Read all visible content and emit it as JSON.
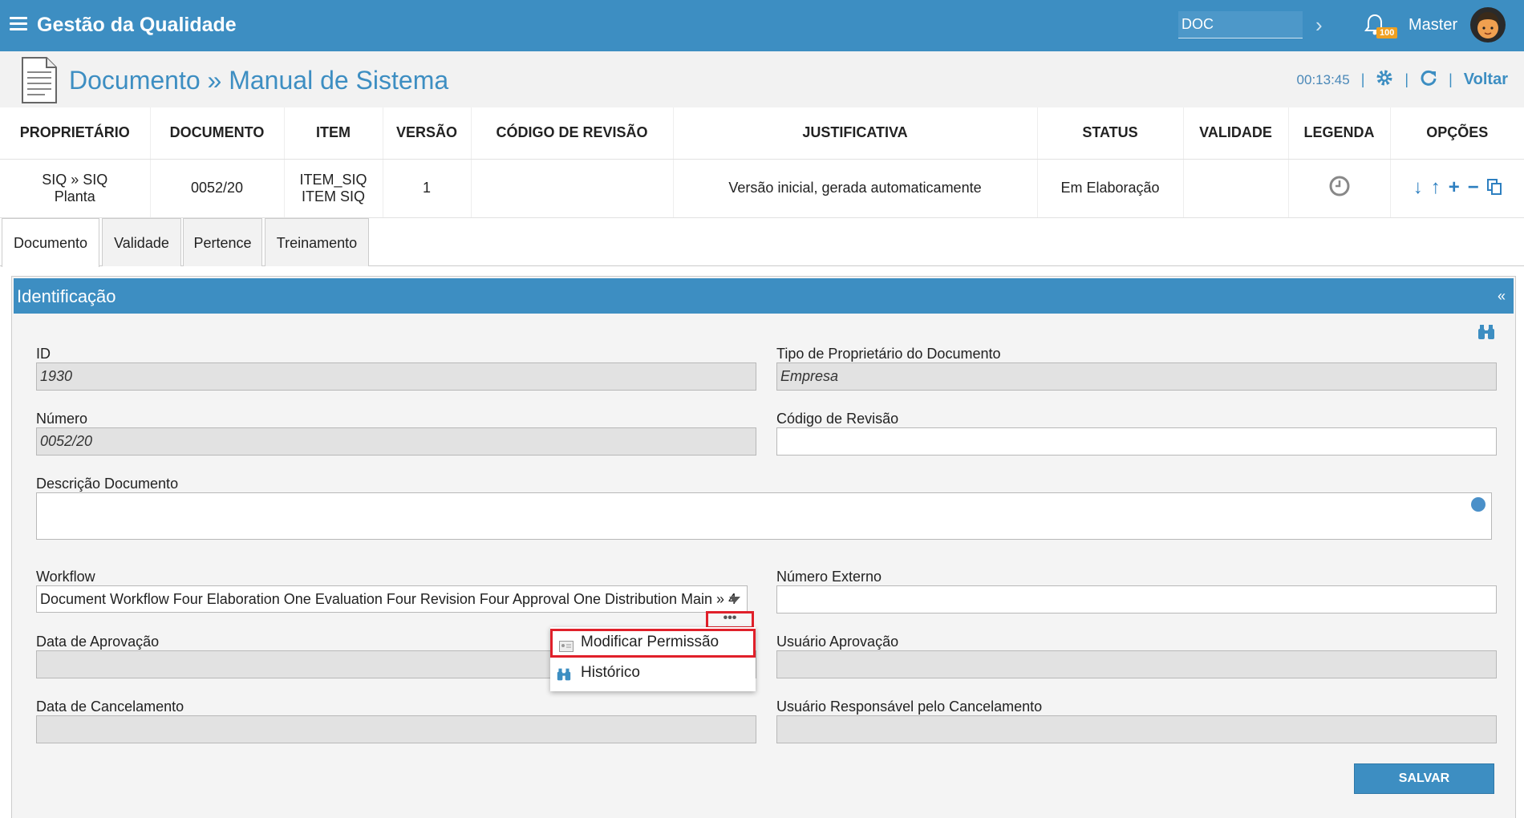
{
  "app": {
    "title": "Gestão da Qualidade"
  },
  "topbar": {
    "search_value": "DOC",
    "notification_count": "100",
    "user_name": "Master"
  },
  "header": {
    "title": "Documento » Manual de Sistema",
    "timer": "00:13:45",
    "back_label": "Voltar",
    "sep": "|"
  },
  "table": {
    "headers": [
      "PROPRIETÁRIO",
      "DOCUMENTO",
      "ITEM",
      "VERSÃO",
      "CÓDIGO DE REVISÃO",
      "JUSTIFICATIVA",
      "STATUS",
      "VALIDADE",
      "LEGENDA",
      "OPÇÕES"
    ],
    "row": {
      "proprietario_1": "SIQ » SIQ",
      "proprietario_2": "Planta",
      "documento": "0052/20",
      "item_1": "ITEM_SIQ",
      "item_2": "ITEM SIQ",
      "versao": "1",
      "codigo_revisao": "",
      "justificativa": "Versão inicial, gerada automaticamente",
      "status": "Em Elaboração",
      "validade": ""
    }
  },
  "tabs": [
    "Documento",
    "Validade",
    "Pertence",
    "Treinamento"
  ],
  "panel": {
    "title": "Identificação",
    "collapse": "«"
  },
  "form": {
    "id_label": "ID",
    "id_value": "1930",
    "tipo_label": "Tipo de Proprietário do Documento",
    "tipo_value": "Empresa",
    "numero_label": "Número",
    "numero_value": "0052/20",
    "codigo_label": "Código de Revisão",
    "codigo_value": "",
    "descricao_label": "Descrição Documento",
    "descricao_value": "",
    "workflow_label": "Workflow",
    "workflow_value": "Document Workflow Four Elaboration One Evaluation Four Revision Four Approval One Distribution Main » 4",
    "externo_label": "Número Externo",
    "externo_value": "",
    "aprovacao_label": "Data de Aprovação",
    "aprovacao_value": "",
    "usuario_aprovacao_label": "Usuário Aprovação",
    "usuario_aprovacao_value": "",
    "cancelamento_label": "Data de Cancelamento",
    "cancelamento_value": "",
    "usuario_cancel_label": "Usuário Responsável pelo Cancelamento",
    "usuario_cancel_value": "",
    "dots": "•••",
    "save_label": "SALVAR"
  },
  "context_menu": {
    "items": [
      "Modificar Permissão",
      "Histórico"
    ]
  },
  "colors": {
    "primary": "#3d8ec2",
    "highlight": "#e0202a",
    "badge": "#f0a020"
  }
}
